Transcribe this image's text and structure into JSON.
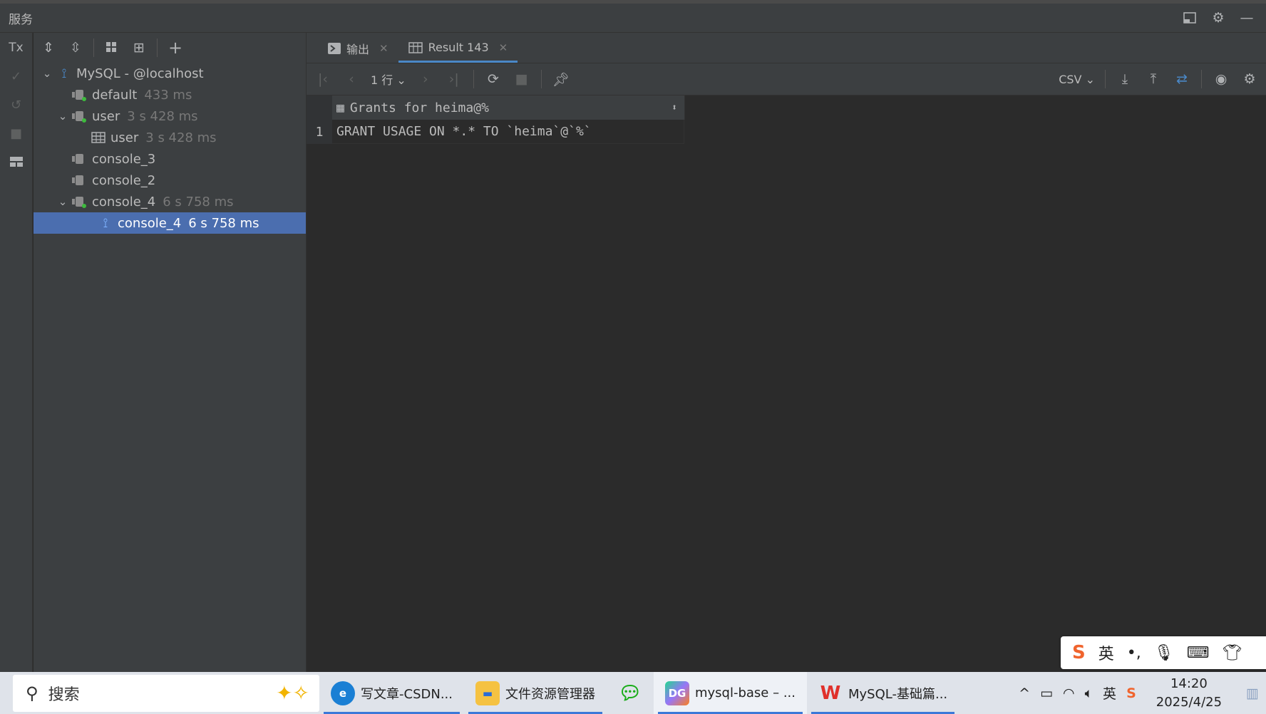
{
  "window": {
    "title": "服务"
  },
  "tree": {
    "items": [
      {
        "label": "MySQL - @localhost",
        "time": ""
      },
      {
        "label": "default",
        "time": "433 ms"
      },
      {
        "label": "user",
        "time": "3 s 428 ms"
      },
      {
        "label": "user",
        "time": "3 s 428 ms"
      },
      {
        "label": "console_3",
        "time": ""
      },
      {
        "label": "console_2",
        "time": ""
      },
      {
        "label": "console_4",
        "time": "6 s 758 ms"
      },
      {
        "label": "console_4",
        "time": "6 s 758 ms"
      }
    ]
  },
  "tabs": [
    {
      "label": "输出"
    },
    {
      "label": "Result 143"
    }
  ],
  "toolbar": {
    "rows_label": "1 行",
    "format_label": "CSV"
  },
  "grid": {
    "columns": [
      "Grants for heima@%"
    ],
    "rows": [
      {
        "num": "1",
        "cells": [
          "GRANT USAGE ON *.* TO `heima`@`%`"
        ]
      }
    ]
  },
  "ime": {
    "lang": "英"
  },
  "taskbar": {
    "search_label": "搜索",
    "apps": [
      {
        "label": "写文章-CSDN..."
      },
      {
        "label": "文件资源管理器"
      },
      {
        "label": "mysql-base – ..."
      },
      {
        "label": "MySQL-基础篇..."
      }
    ],
    "tray_lang": "英",
    "time": "14:20",
    "date": "2025/4/25"
  },
  "colors": {
    "selection": "#4b6eaf",
    "background": "#2b2b2b",
    "panel": "#3c3f41",
    "accent": "#4a88c7"
  }
}
